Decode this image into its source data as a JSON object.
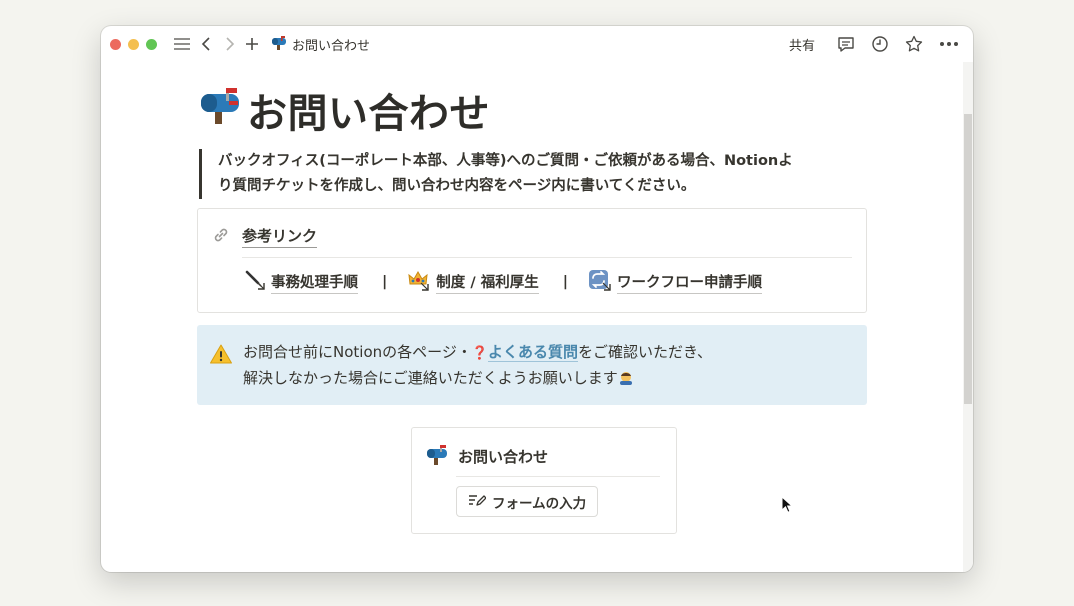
{
  "titlebar": {
    "breadcrumb": "お問い合わせ",
    "share_label": "共有"
  },
  "page": {
    "title": "お問い合わせ",
    "quote_line1": "バックオフィス(コーポレート本部、人事等)へのご質問・ご依頼がある場合、Notionよ",
    "quote_line2": "り質問チケットを作成し、問い合わせ内容をページ内に書いてください。"
  },
  "links": {
    "title": "参考リンク",
    "items": [
      {
        "label": "事務処理手順",
        "icon": "pen-icon"
      },
      {
        "label": "制度 / 福利厚生",
        "icon": "crown-icon"
      },
      {
        "label": "ワークフロー申請手順",
        "icon": "repeat-icon"
      }
    ],
    "separator": "|"
  },
  "callout": {
    "icon": "warning-icon",
    "line1_prefix": "お問合せ前にNotionの各ページ・",
    "faq_link": "よくある質問",
    "line1_suffix": "をご確認いただき、",
    "line2": "解決しなかった場合にご連絡いただくようお願いします",
    "bg_color": "#e1eef5",
    "link_color": "#4a88ad"
  },
  "form": {
    "title": "お問い合わせ",
    "button_label": "フォームの入力"
  }
}
